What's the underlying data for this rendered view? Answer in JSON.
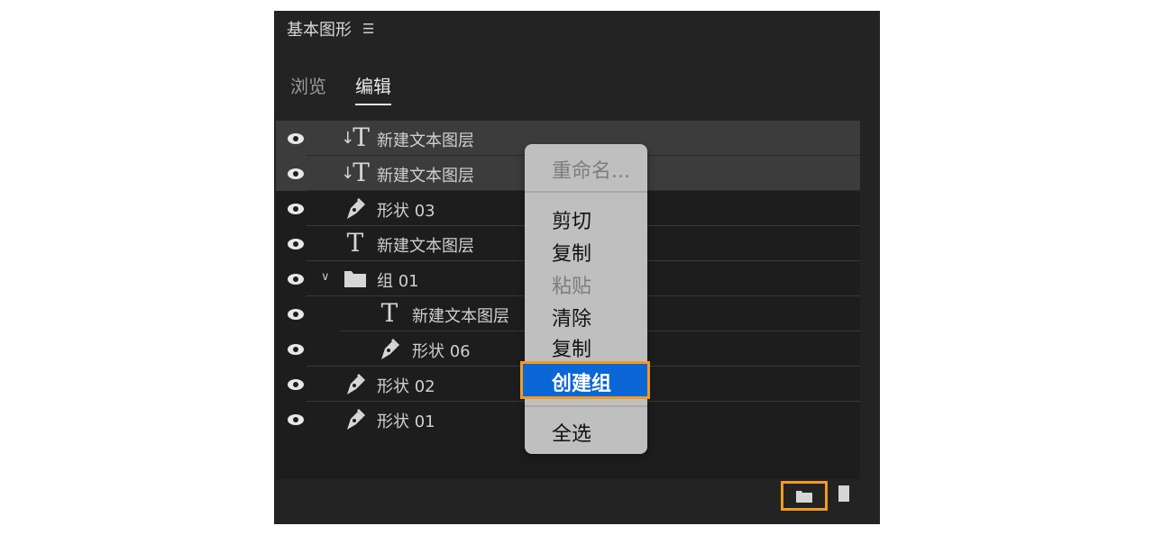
{
  "panel": {
    "title": "基本图形",
    "menu_icon": "hamburger-menu-icon"
  },
  "tabs": [
    {
      "label": "浏览",
      "active": false
    },
    {
      "label": "编辑",
      "active": true
    }
  ],
  "layers": [
    {
      "label": "新建文本图层",
      "icon": "text-layer-icon",
      "selected": true
    },
    {
      "label": "新建文本图层",
      "icon": "text-layer-icon",
      "selected": true
    },
    {
      "label": "形状 03",
      "icon": "pen-icon",
      "selected": false
    },
    {
      "label": "新建文本图层",
      "icon": "text-icon",
      "selected": false
    },
    {
      "label": "组 01",
      "icon": "folder-icon",
      "selected": false,
      "expanded": true
    },
    {
      "label": "新建文本图层",
      "icon": "text-icon",
      "selected": false,
      "indented": true
    },
    {
      "label": "形状 06",
      "icon": "pen-icon",
      "selected": false,
      "indented": true
    },
    {
      "label": "形状 02",
      "icon": "pen-icon",
      "selected": false
    },
    {
      "label": "形状 01",
      "icon": "pen-icon",
      "selected": false
    }
  ],
  "context_menu": {
    "items": [
      {
        "label": "重命名...",
        "disabled": true
      },
      {
        "label": "剪切",
        "disabled": false
      },
      {
        "label": "复制",
        "disabled": false
      },
      {
        "label": "粘贴",
        "disabled": true
      },
      {
        "label": "清除",
        "disabled": false
      },
      {
        "label": "复制",
        "disabled": false
      },
      {
        "label": "创建组",
        "disabled": false,
        "highlighted": true
      },
      {
        "label": "全选",
        "disabled": false
      }
    ]
  },
  "footer": {
    "new_group_icon": "folder-icon",
    "new_layer_icon": "new-layer-icon"
  },
  "colors": {
    "accent": "#f39a20",
    "highlight": "#0b66d6",
    "panel_bg": "#232323"
  }
}
